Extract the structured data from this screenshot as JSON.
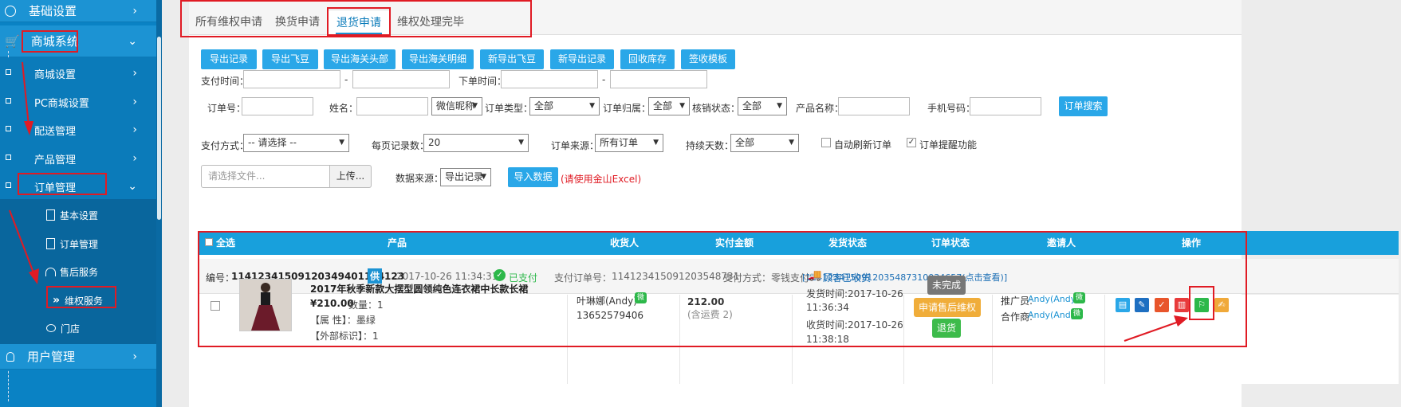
{
  "sidebar": {
    "top_items": [
      {
        "label": "基础设置",
        "icon": "globe-icon"
      },
      {
        "label": "商城系统",
        "icon": "cart-icon"
      },
      {
        "label": "用户管理",
        "icon": "user-icon"
      }
    ],
    "sub_items": [
      {
        "label": "商城设置"
      },
      {
        "label": "PC商城设置"
      },
      {
        "label": "配送管理"
      },
      {
        "label": "产品管理"
      },
      {
        "label": "订单管理"
      }
    ],
    "leaf_items": [
      {
        "label": "基本设置",
        "icon": "clipboard-icon"
      },
      {
        "label": "订单管理",
        "icon": "clipboard-icon"
      },
      {
        "label": "售后服务",
        "icon": "headset-icon"
      },
      {
        "label": "维权服务",
        "icon": "double-chevron-icon"
      },
      {
        "label": "门店",
        "icon": "chat-icon"
      }
    ]
  },
  "tabs": [
    "所有维权申请",
    "换货申请",
    "退货申请",
    "维权处理完毕"
  ],
  "toolbar": [
    "导出记录",
    "导出飞豆",
    "导出海关头部",
    "导出海关明细",
    "新导出飞豆",
    "新导出记录",
    "回收库存",
    "签收模板"
  ],
  "filters": {
    "pay_time": "支付时间：",
    "order_time": "下单时间：",
    "dash": "-",
    "order_no": "订单号：",
    "name": "姓名：",
    "wechat_nick": "微信昵称",
    "order_type": "订单类型：",
    "order_type_value": "全部",
    "order_owner": "订单归属：",
    "order_owner_value": "全部",
    "verify_status": "核销状态：",
    "verify_status_value": "全部",
    "product_name": "产品名称：",
    "phone": "手机号码：",
    "search_btn": "订单搜索",
    "pay_method": "支付方式：",
    "pay_method_value": "-- 请选择 --",
    "page_size": "每页记录数：",
    "page_size_value": "20",
    "order_source": "订单来源：",
    "order_source_value": "所有订单",
    "duration": "持续天数：",
    "duration_value": "全部",
    "auto_refresh": "自动刷新订单",
    "order_remind": "订单提醒功能",
    "file_placeholder": "请选择文件...",
    "upload_btn": "上传...",
    "data_source": "数据来源：",
    "data_source_value": "导出记录",
    "import_btn": "导入数据",
    "import_hint": "(请使用金山Excel)"
  },
  "table": {
    "headers": [
      "全选",
      "产品",
      "收货人",
      "实付金额",
      "发货状态",
      "订单状态",
      "邀请人",
      "操作"
    ]
  },
  "order": {
    "no_label": "编号：",
    "no": "11412341509120349401114123",
    "supply_tag": "供",
    "time": "2017-10-26 11:34:31",
    "paid": "已支付",
    "pay_order_label": "支付订单号：",
    "pay_order_no": "114123415091203548731",
    "pay_method_text": "支付方式：零钱支付",
    "pay_link": "[1141234150912035487310034657(点击查看)]",
    "product_title": "2017年秋季新款大摆型圆领纯色连衣裙中长款长裙",
    "price": "¥210.00",
    "qty": "数量：1",
    "attr": "【属 性】：墨绿",
    "ext_id": "【外部标识】：1",
    "consignee": "叶琳娜(Andy)",
    "consignee_phone": "13652579406",
    "amount": "212.00",
    "shipping_fee": "(含运费 2)",
    "ship_status": "顾客已收货",
    "ship_time_label": "发货时间:2017-10-26",
    "ship_time_2": "11:36:34",
    "recv_time_label": "收货时间:2017-10-26",
    "recv_time_2": "11:38:18",
    "status_incomplete": "未完成",
    "status_apply": "申请售后维权",
    "status_refund": "退货",
    "promoter_label": "推广员:",
    "promoter": "Andy(Andy)",
    "partner_label": "合作商:",
    "partner": "Andy(Andy)"
  },
  "colors": {
    "sidebar": "#0a82c4",
    "accent": "#2aa7e8",
    "highlight": "#e01b24",
    "paid": "#2db84a"
  }
}
